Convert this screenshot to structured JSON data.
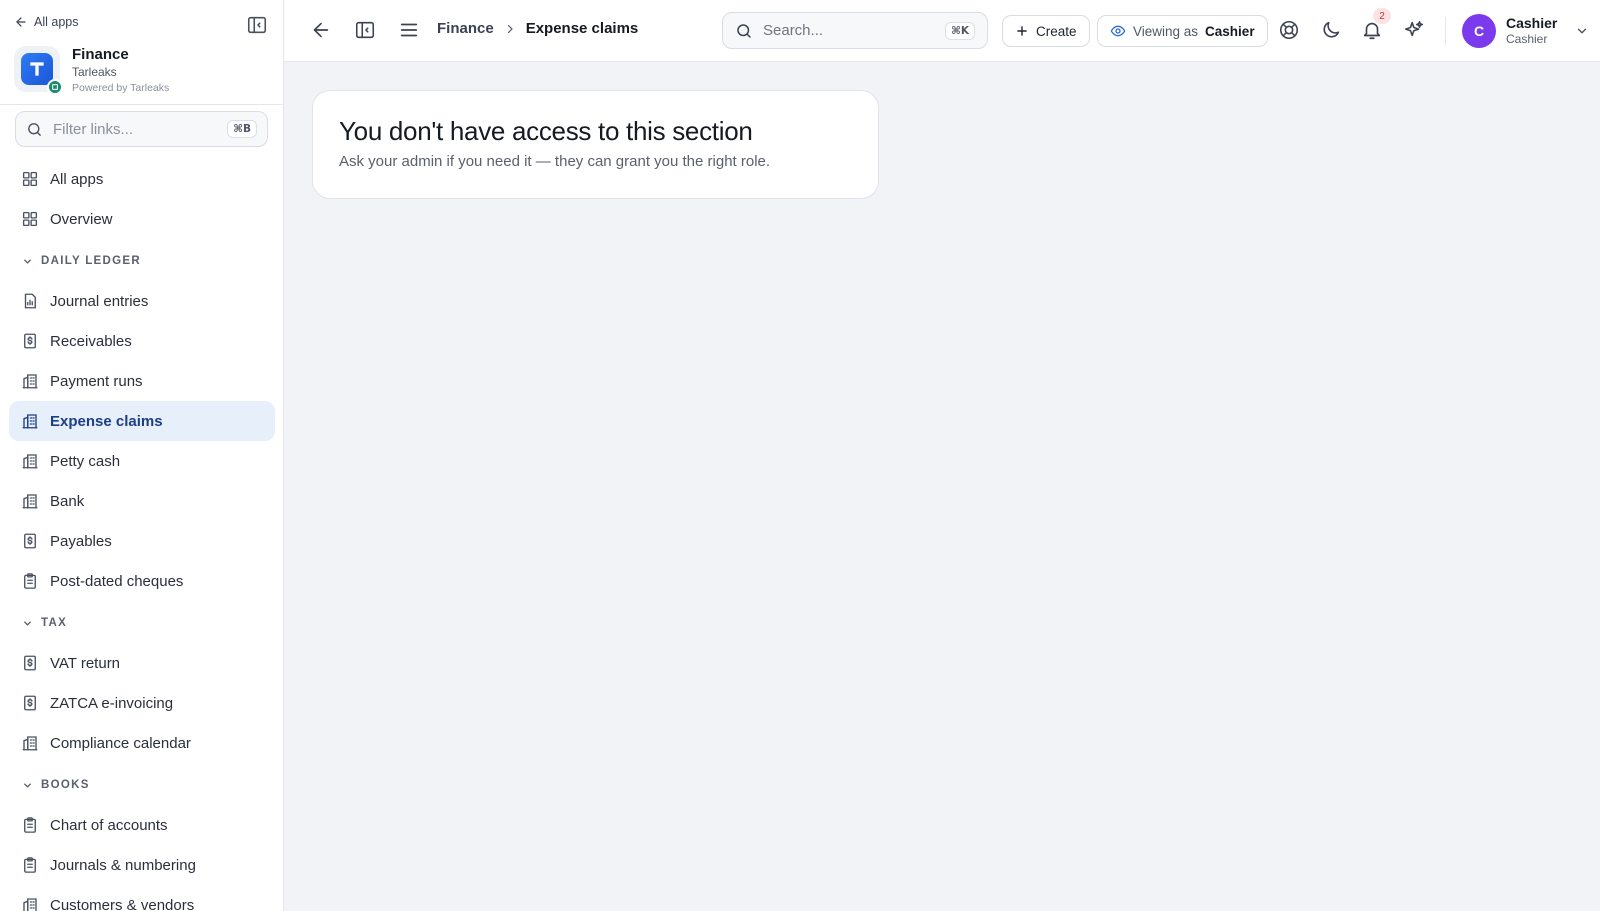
{
  "sidebar": {
    "back_label": "All apps",
    "brand": {
      "name": "Finance",
      "org": "Tarleaks",
      "powered": "Powered by Tarleaks"
    },
    "filter": {
      "placeholder": "Filter links...",
      "shortcut": "⌘B"
    },
    "top_items": [
      {
        "label": "All apps",
        "icon": "grid-icon"
      },
      {
        "label": "Overview",
        "icon": "grid-icon"
      }
    ],
    "sections": [
      {
        "title": "DAILY LEDGER",
        "items": [
          {
            "label": "Journal entries",
            "icon": "report-icon"
          },
          {
            "label": "Receivables",
            "icon": "dollar-doc-icon"
          },
          {
            "label": "Payment runs",
            "icon": "building-icon"
          },
          {
            "label": "Expense claims",
            "icon": "building-icon",
            "active": true
          },
          {
            "label": "Petty cash",
            "icon": "building-icon"
          },
          {
            "label": "Bank",
            "icon": "building-icon"
          },
          {
            "label": "Payables",
            "icon": "dollar-doc-icon"
          },
          {
            "label": "Post-dated cheques",
            "icon": "clipboard-icon"
          }
        ]
      },
      {
        "title": "TAX",
        "items": [
          {
            "label": "VAT return",
            "icon": "dollar-doc-icon"
          },
          {
            "label": "ZATCA e-invoicing",
            "icon": "dollar-doc-icon"
          },
          {
            "label": "Compliance calendar",
            "icon": "building-icon"
          }
        ]
      },
      {
        "title": "BOOKS",
        "items": [
          {
            "label": "Chart of accounts",
            "icon": "clipboard-icon"
          },
          {
            "label": "Journals & numbering",
            "icon": "clipboard-icon"
          },
          {
            "label": "Customers & vendors",
            "icon": "building-icon"
          }
        ]
      }
    ]
  },
  "topbar": {
    "breadcrumb": [
      "Finance",
      "Expense claims"
    ],
    "search": {
      "placeholder": "Search...",
      "shortcut": "⌘K"
    },
    "create_label": "Create",
    "viewing_as_label": "Viewing as",
    "viewing_as_role": "Cashier",
    "notification_count": "2",
    "user": {
      "initial": "C",
      "name": "Cashier",
      "role": "Cashier"
    }
  },
  "main": {
    "title": "You don't have access to this section",
    "subtitle": "Ask your admin if you need it — they can grant you the right role."
  },
  "colors": {
    "accent": "#1d3f86",
    "active_bg": "#e6effa",
    "avatar": "#7c3aed",
    "brand": "#2f7bf5"
  }
}
